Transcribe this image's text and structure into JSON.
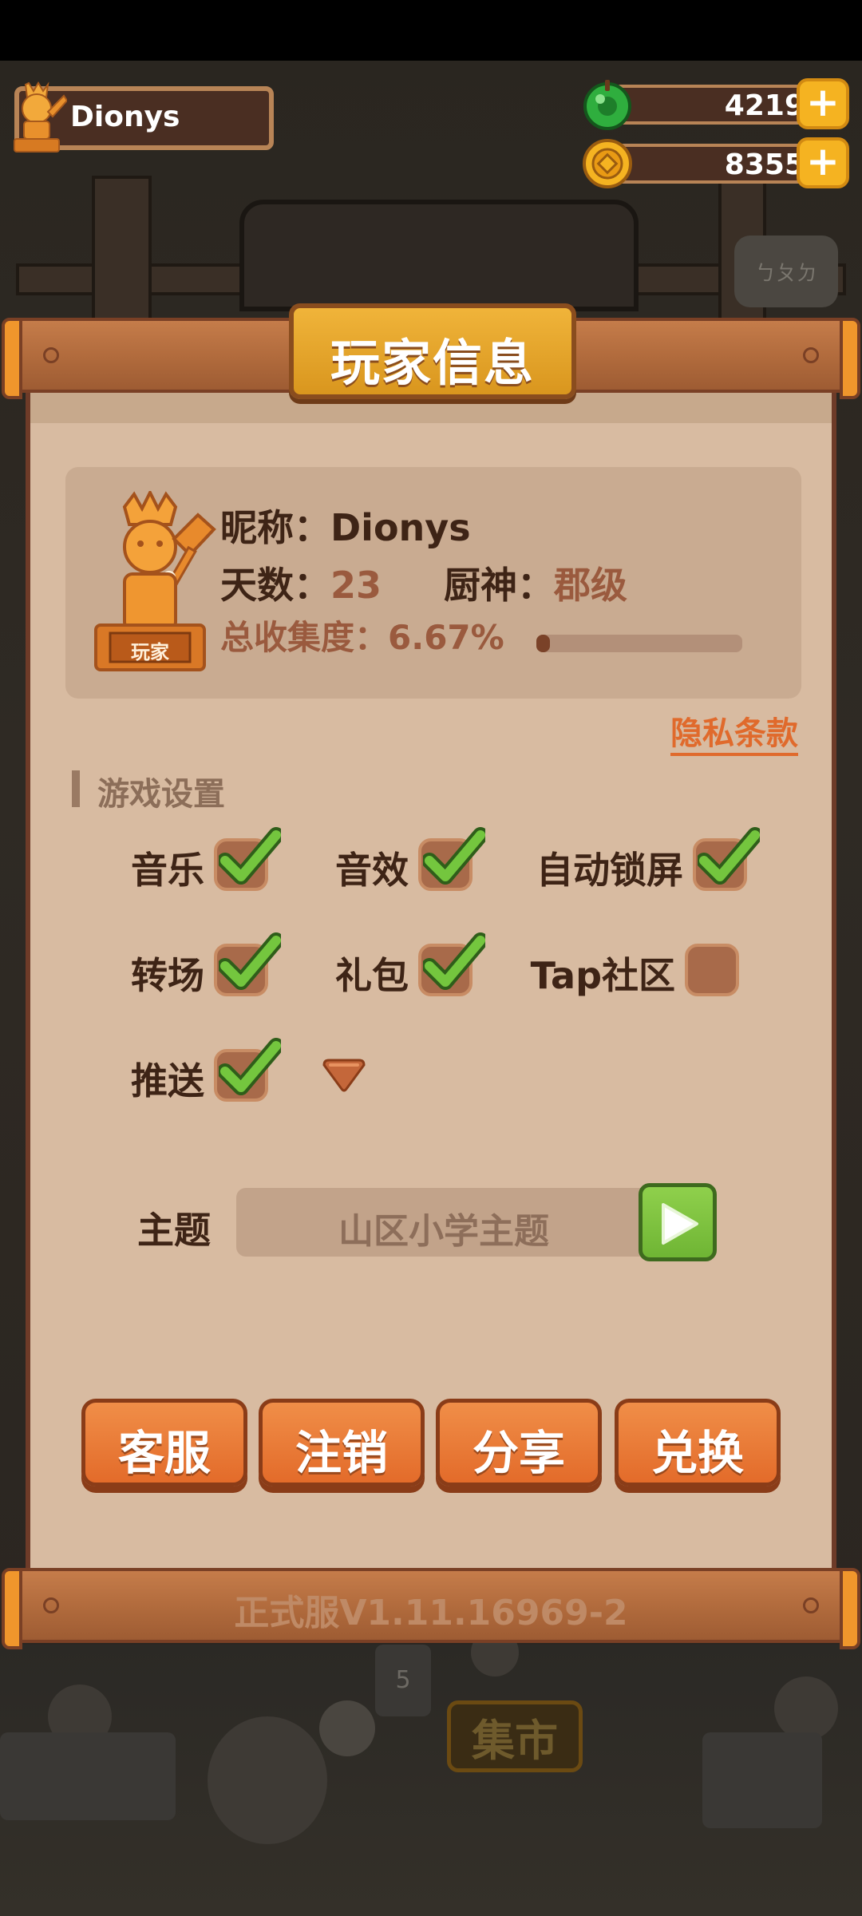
{
  "hud": {
    "player_name": "Dionys",
    "jade_amount": "4219",
    "coin_amount": "8355",
    "plus_symbol": "+"
  },
  "background": {
    "sign_text": "ㄅㄆㄉ",
    "market_sign": "集市",
    "card_number": "5"
  },
  "panel": {
    "title": "玩家信息",
    "profile": {
      "nickname_label": "昵称：",
      "nickname_value": "Dionys",
      "days_label": "天数：",
      "days_value": "23",
      "chef_label": "厨神：",
      "chef_value": "郡级",
      "collection_label": "总收集度：",
      "collection_value": "6.67%",
      "collection_progress": 0.0667,
      "trophy_label": "玩家"
    },
    "privacy_link": "隐私条款",
    "settings_title": "游戏设置",
    "settings": [
      {
        "label": "音乐",
        "checked": true
      },
      {
        "label": "音效",
        "checked": true
      },
      {
        "label": "自动锁屏",
        "checked": true
      },
      {
        "label": "转场",
        "checked": true
      },
      {
        "label": "礼包",
        "checked": true
      },
      {
        "label": "Tap社区",
        "checked": false
      },
      {
        "label": "推送",
        "checked": true
      }
    ],
    "theme_label": "主题",
    "theme_value": "山区小学主题",
    "buttons": {
      "service": "客服",
      "logout": "注销",
      "share": "分享",
      "redeem": "兑换"
    },
    "version": "正式服V1.11.16969-2"
  },
  "colors": {
    "panel_bg": "#d8bba1",
    "accent_orange": "#e36b2a",
    "check_green": "#6cbd3a",
    "title_gold": "#f0b43a"
  }
}
